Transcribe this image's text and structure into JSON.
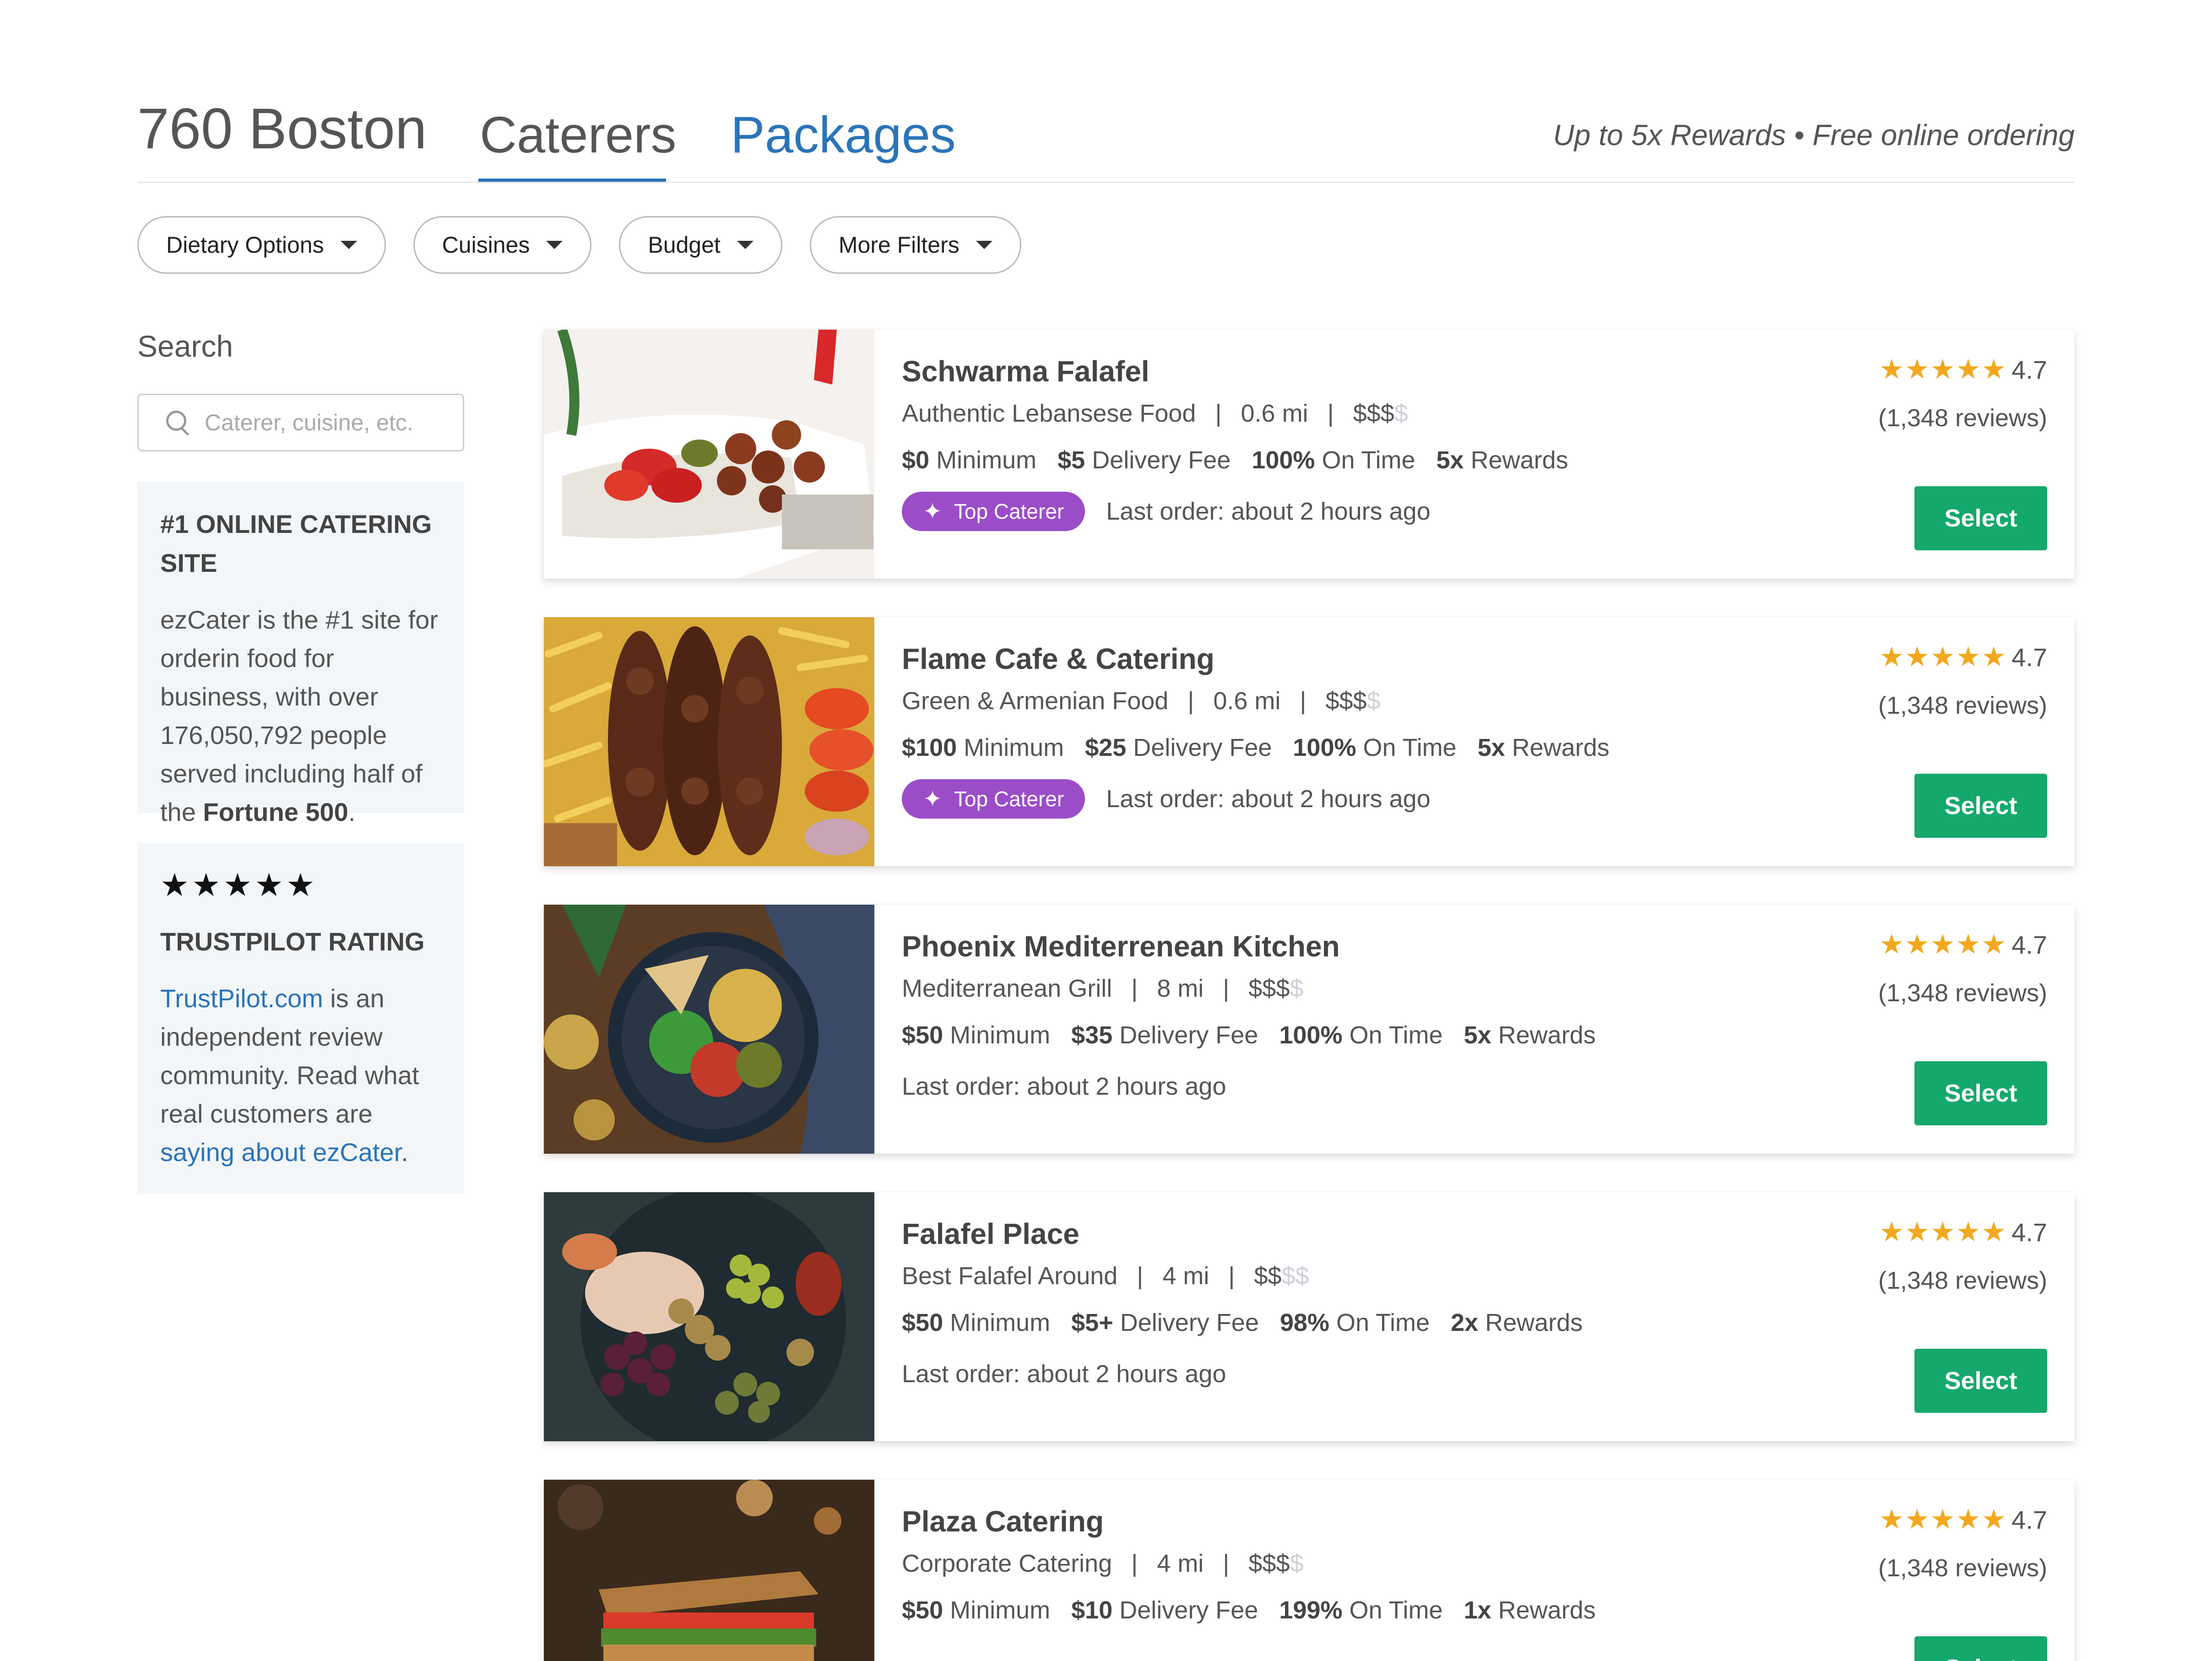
{
  "header": {
    "location": "760 Boston",
    "tabs": [
      {
        "label": "Caterers",
        "active": true
      },
      {
        "label": "Packages",
        "active": false
      }
    ],
    "promo": "Up to 5x Rewards • Free online ordering"
  },
  "filters": [
    "Dietary Options",
    "Cuisines",
    "Budget",
    "More Filters"
  ],
  "sidebar": {
    "search_title": "Search",
    "search_placeholder": "Caterer, cuisine, etc.",
    "box1": {
      "heading": "#1 ONLINE CATERING SITE",
      "text_before": "ezCater is the #1 site for orderin food for business, with over 176,050,792 people served including half of the",
      "text_bold": "Fortune 500",
      "text_after": "."
    },
    "box2": {
      "stars": "★★★★★",
      "heading": "TRUSTPILOT RATING",
      "link1": "TrustPilot.com",
      "text_mid": " is an independent review community. Read what real customers are ",
      "link2": "saying about ezCater",
      "text_end": "."
    }
  },
  "listings": [
    {
      "name": "Schwarma Falafel",
      "cuisine": "Authentic Lebansese Food",
      "distance": "0.6 mi",
      "price_active": "$$$",
      "price_dim": "$",
      "minimum": "$0",
      "minimum_label": "Minimum",
      "delivery": "$5",
      "delivery_label": "Delivery Fee",
      "ontime": "100%",
      "ontime_label": "On Time",
      "rewards": "5x",
      "rewards_label": "Rewards",
      "badge": "Top Caterer",
      "last_order": "Last order: about 2 hours ago",
      "stars": "★★★★★",
      "rating": "4.7",
      "reviews": "(1,348  reviews)",
      "select": "Select"
    },
    {
      "name": "Flame Cafe & Catering",
      "cuisine": "Green & Armenian Food",
      "distance": "0.6 mi",
      "price_active": "$$$",
      "price_dim": "$",
      "minimum": "$100",
      "minimum_label": "Minimum",
      "delivery": "$25",
      "delivery_label": "Delivery Fee",
      "ontime": "100%",
      "ontime_label": "On Time",
      "rewards": "5x",
      "rewards_label": "Rewards",
      "badge": "Top Caterer",
      "last_order": "Last order: about 2 hours ago",
      "stars": "★★★★★",
      "rating": "4.7",
      "reviews": "(1,348  reviews)",
      "select": "Select"
    },
    {
      "name": "Phoenix Mediterrenean Kitchen",
      "cuisine": "Mediterranean Grill",
      "distance": "8 mi",
      "price_active": "$$$",
      "price_dim": "$",
      "minimum": "$50",
      "minimum_label": "Minimum",
      "delivery": "$35",
      "delivery_label": "Delivery Fee",
      "ontime": "100%",
      "ontime_label": "On Time",
      "rewards": "5x",
      "rewards_label": "Rewards",
      "badge": "",
      "last_order": "Last order: about 2 hours ago",
      "stars": "★★★★★",
      "rating": "4.7",
      "reviews": "(1,348  reviews)",
      "select": "Select"
    },
    {
      "name": "Falafel Place",
      "cuisine": "Best Falafel Around",
      "distance": "4 mi",
      "price_active": "$$",
      "price_dim": "$$",
      "minimum": "$50",
      "minimum_label": "Minimum",
      "delivery": "$5+",
      "delivery_label": "Delivery Fee",
      "ontime": "98%",
      "ontime_label": "On Time",
      "rewards": "2x",
      "rewards_label": "Rewards",
      "badge": "",
      "last_order": "Last order: about 2 hours ago",
      "stars": "★★★★★",
      "rating": "4.7",
      "reviews": "(1,348  reviews)",
      "select": "Select"
    },
    {
      "name": "Plaza Catering",
      "cuisine": "Corporate Catering",
      "distance": "4 mi",
      "price_active": "$$$",
      "price_dim": "$",
      "minimum": "$50",
      "minimum_label": "Minimum",
      "delivery": "$10",
      "delivery_label": "Delivery Fee",
      "ontime": "199%",
      "ontime_label": "On Time",
      "rewards": "1x",
      "rewards_label": "Rewards",
      "badge": "",
      "last_order": "",
      "stars": "★★★★★",
      "rating": "4.7",
      "reviews": "(1,348  reviews)",
      "select": "Select"
    }
  ],
  "colors": {
    "accent_blue": "#2a74b8",
    "select_green": "#14a86b",
    "badge_purple": "#9b4dc8",
    "star_gold": "#f2a81d"
  }
}
